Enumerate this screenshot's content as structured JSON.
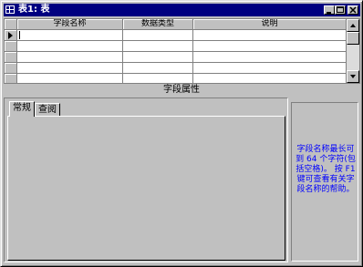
{
  "window": {
    "title": "表1: 表"
  },
  "grid": {
    "columns": [
      "字段名称",
      "数据类型",
      "说明"
    ]
  },
  "properties": {
    "label": "字段属性",
    "tabs": [
      "常规",
      "查阅"
    ],
    "help_text": "字段名称最长可到 64 个字符(包括空格)。 按 F1 键可查看有关字段名称的帮助。"
  },
  "colors": {
    "titlebar": "#000080",
    "help_text": "#0000ff",
    "face": "#c0c0c0"
  }
}
